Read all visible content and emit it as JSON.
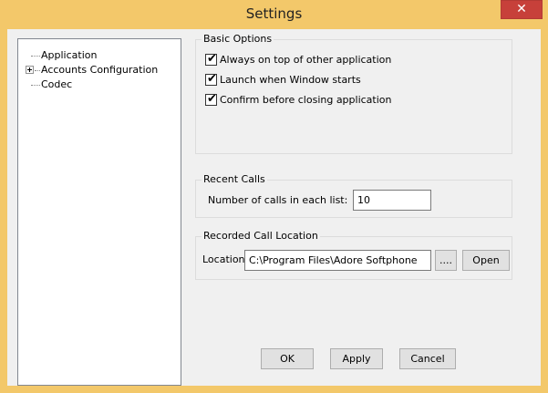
{
  "window": {
    "title": "Settings",
    "close_glyph": "✕"
  },
  "tree": {
    "items": [
      {
        "label": "Application",
        "expandable": false
      },
      {
        "label": "Accounts Configuration",
        "expandable": true
      },
      {
        "label": "Codec",
        "expandable": false
      }
    ]
  },
  "basic_options": {
    "title": "Basic Options",
    "options": [
      {
        "label": "Always on top of other application",
        "checked": true
      },
      {
        "label": "Launch when Window starts",
        "checked": true
      },
      {
        "label": "Confirm before closing application",
        "checked": true
      }
    ]
  },
  "recent_calls": {
    "title": "Recent Calls",
    "calls_label": "Number of calls in each list:",
    "calls_value": "10"
  },
  "recorded_location": {
    "title": "Recorded Call Location",
    "location_label": "Location:",
    "location_value": "C:\\Program Files\\Adore Softphone",
    "browse_label": "....",
    "open_label": "Open"
  },
  "footer": {
    "ok_label": "OK",
    "apply_label": "Apply",
    "cancel_label": "Cancel"
  },
  "icons": {
    "check": "✔",
    "expander": "plus-box-icon"
  },
  "colors": {
    "title_bar": "#f3c86a",
    "close_button": "#c7403a",
    "client": "#f0f0f0"
  }
}
